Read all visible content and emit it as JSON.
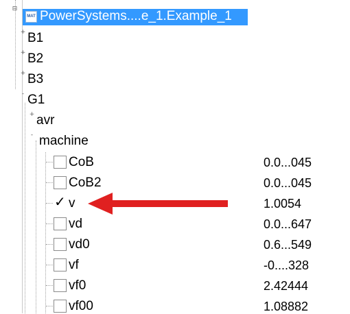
{
  "root": {
    "label": "PowerSystems....e_1.Example_1",
    "icon": "mat-file-icon",
    "icon_text": "MAT"
  },
  "nodes": [
    {
      "label": "B1",
      "expander": "+"
    },
    {
      "label": "B2",
      "expander": "+"
    },
    {
      "label": "B3",
      "expander": "+"
    },
    {
      "label": "G1",
      "expander": "-"
    }
  ],
  "g1_children": [
    {
      "label": "avr",
      "expander": "+"
    },
    {
      "label": "machine",
      "expander": "-"
    }
  ],
  "variables": [
    {
      "label": "CoB",
      "checked": false,
      "value": "0.0...045"
    },
    {
      "label": "CoB2",
      "checked": false,
      "value": "0.0...045"
    },
    {
      "label": "v",
      "checked": true,
      "value": "1.0054"
    },
    {
      "label": "vd",
      "checked": false,
      "value": "0.0...647"
    },
    {
      "label": "vd0",
      "checked": false,
      "value": "0.6...549"
    },
    {
      "label": "vf",
      "checked": false,
      "value": "-0....328"
    },
    {
      "label": "vf0",
      "checked": false,
      "value": "2.42444"
    },
    {
      "label": "vf00",
      "checked": false,
      "value": "1.08882"
    }
  ],
  "colors": {
    "selection": "#3399ff",
    "arrow": "#e02020"
  },
  "checkmark_glyph": "✓"
}
